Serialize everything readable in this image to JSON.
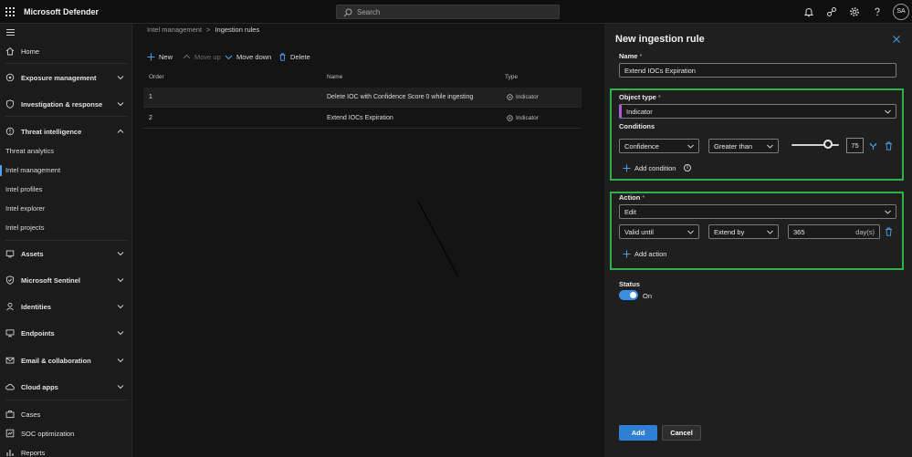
{
  "app": {
    "title": "Microsoft Defender",
    "user_initials": "SA"
  },
  "search": {
    "placeholder": "Search"
  },
  "topbar_icons": [
    "bell-icon",
    "connections-icon",
    "gear-icon",
    "help-icon"
  ],
  "sidebar": {
    "items": [
      {
        "label": "Home",
        "icon": "home-icon",
        "expandable": false
      },
      {
        "label": "Exposure management",
        "icon": "exposure-icon",
        "expandable": true
      },
      {
        "label": "Investigation & response",
        "icon": "shield-icon",
        "expandable": true
      },
      {
        "label": "Threat intelligence",
        "icon": "threat-intel-icon",
        "expandable": true,
        "expanded": true
      },
      {
        "label": "Assets",
        "icon": "assets-icon",
        "expandable": true
      },
      {
        "label": "Microsoft Sentinel",
        "icon": "sentinel-icon",
        "expandable": true
      },
      {
        "label": "Identities",
        "icon": "identities-icon",
        "expandable": true
      },
      {
        "label": "Endpoints",
        "icon": "endpoints-icon",
        "expandable": true
      },
      {
        "label": "Email & collaboration",
        "icon": "email-icon",
        "expandable": true
      },
      {
        "label": "Cloud apps",
        "icon": "cloud-icon",
        "expandable": true
      },
      {
        "label": "Cases",
        "icon": "cases-icon",
        "expandable": false
      },
      {
        "label": "SOC optimization",
        "icon": "soc-icon",
        "expandable": false
      },
      {
        "label": "Reports",
        "icon": "reports-icon",
        "expandable": false
      }
    ],
    "threat_intel_sub": [
      "Threat analytics",
      "Intel management",
      "Intel profiles",
      "Intel explorer",
      "Intel projects"
    ],
    "active_sub": "Intel management"
  },
  "breadcrumb": {
    "parent": "Intel management",
    "current": "Ingestion rules"
  },
  "toolbar": {
    "new": "New",
    "move_up": "Move up",
    "move_down": "Move down",
    "delete": "Delete"
  },
  "table": {
    "headers": {
      "order": "Order",
      "name": "Name",
      "type": "Type"
    },
    "rows": [
      {
        "order": "1",
        "name": "Delete IOC with Confidence Score 0 while ingesting",
        "type": "Indicator"
      },
      {
        "order": "2",
        "name": "Extend IOCs Expiration",
        "type": "Indicator"
      }
    ]
  },
  "panel": {
    "title": "New ingestion rule",
    "name_label": "Name",
    "name_value": "Extend IOCs Expiration",
    "object_type_label": "Object type",
    "object_type_value": "Indicator",
    "conditions_label": "Conditions",
    "condition": {
      "field": "Confidence",
      "operator": "Greater than",
      "value": "75",
      "slider_fraction": 0.75
    },
    "add_condition": "Add condition",
    "action_label": "Action",
    "action_value": "Edit",
    "action_row": {
      "field": "Valid until",
      "operator": "Extend by",
      "value": "365",
      "unit": "day(s)"
    },
    "add_action": "Add action",
    "status_label": "Status",
    "status_value": "On",
    "add_button": "Add",
    "cancel_button": "Cancel"
  },
  "colors": {
    "highlight_box": "#2fb24a",
    "accent": "#2f7fd6",
    "required": "#f28b82"
  }
}
